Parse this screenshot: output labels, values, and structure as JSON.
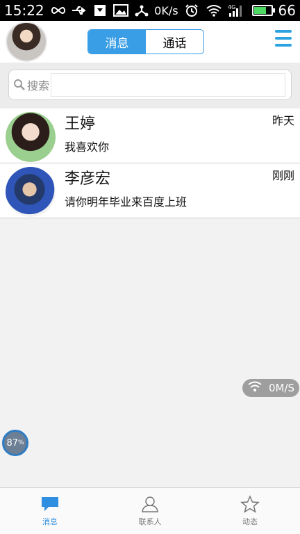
{
  "status_bar": {
    "time": "15:22",
    "net_speed": "0K/s",
    "battery": "66",
    "battery_level": 0.66,
    "icons": [
      "infinity-icon",
      "usb-icon",
      "download-icon",
      "image-icon",
      "share-icon",
      "alarm-icon",
      "wifi-icon",
      "signal-4g-icon",
      "battery-icon"
    ]
  },
  "header": {
    "tabs": [
      {
        "label": "消息",
        "active": true
      },
      {
        "label": "通话",
        "active": false
      }
    ],
    "accent_color": "#3a9ee6",
    "menu_icon": "hamburger-icon"
  },
  "search": {
    "label": "搜索",
    "placeholder": "",
    "value": ""
  },
  "conversations": [
    {
      "name": "王婷",
      "message": "我喜欢你",
      "time": "昨天"
    },
    {
      "name": "李彦宏",
      "message": "请你明年毕业来百度上班",
      "time": "刚刚"
    }
  ],
  "overlay": {
    "speed": "0M/S",
    "memory": "87",
    "memory_unit": "%"
  },
  "bottom_nav": [
    {
      "label": "消息",
      "icon": "chat-bubble-icon",
      "active": true
    },
    {
      "label": "联系人",
      "icon": "person-icon",
      "active": false
    },
    {
      "label": "动态",
      "icon": "star-icon",
      "active": false
    }
  ]
}
